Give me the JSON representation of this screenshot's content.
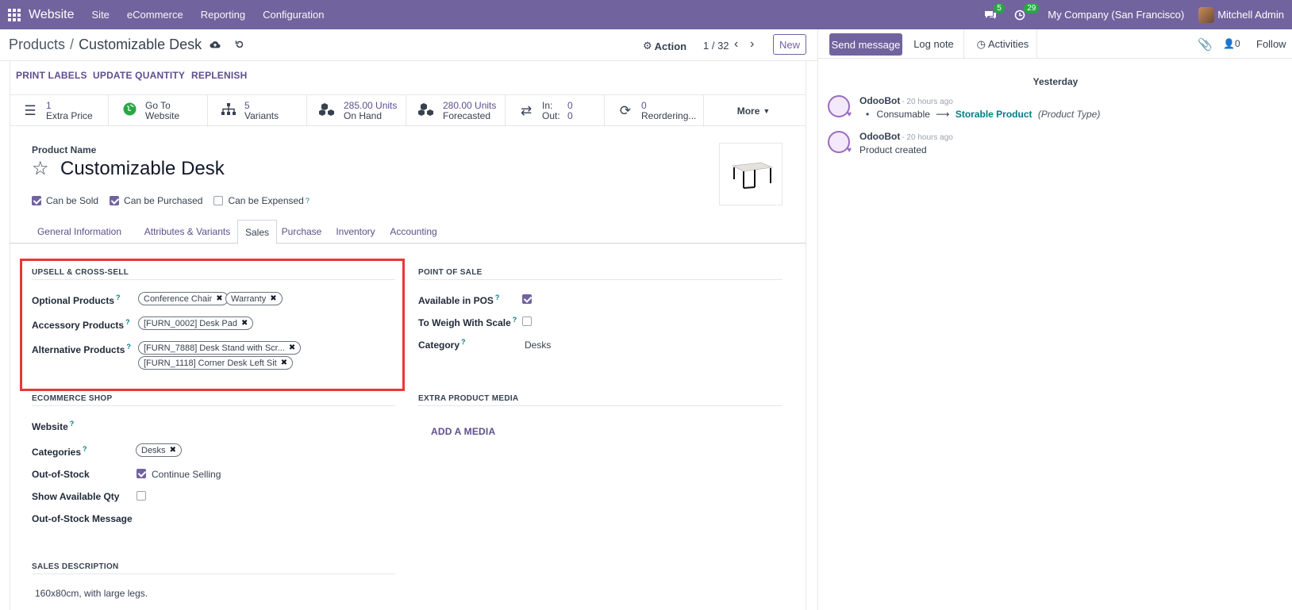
{
  "navbar": {
    "brand": "Website",
    "menus": [
      "Site",
      "eCommerce",
      "Reporting",
      "Configuration"
    ],
    "messages_count": "5",
    "activities_count": "29",
    "company": "My Company (San Francisco)",
    "user": "Mitchell Admin"
  },
  "control": {
    "breadcrumb_parent": "Products",
    "breadcrumb_sep": "/",
    "breadcrumb_current": "Customizable Desk",
    "action_label": "Action",
    "pager": "1 / 32",
    "new_label": "New"
  },
  "header_buttons": {
    "print_labels": "PRINT LABELS",
    "update_quantity": "UPDATE QUANTITY",
    "replenish": "REPLENISH"
  },
  "smart_buttons": {
    "extra_price_value": "1",
    "extra_price_label": "Extra Price",
    "website_value": "Go To",
    "website_label": "Website",
    "variants_value": "5",
    "variants_label": "Variants",
    "onhand_value": "285.00 Units",
    "onhand_label": "On Hand",
    "forecast_value": "280.00 Units",
    "forecast_label": "Forecasted",
    "in_label": "In:",
    "in_value": "0",
    "out_label": "Out:",
    "out_value": "0",
    "reorder_value": "0",
    "reorder_label": "Reordering...",
    "more_label": "More"
  },
  "product": {
    "name_label": "Product Name",
    "name": "Customizable Desk",
    "can_be_sold": "Can be Sold",
    "can_be_purchased": "Can be Purchased",
    "can_be_expensed": "Can be Expensed"
  },
  "tabs": [
    "General Information",
    "Attributes & Variants",
    "Sales",
    "Purchase",
    "Inventory",
    "Accounting"
  ],
  "upsell": {
    "title": "UPSELL & CROSS-SELL",
    "optional_label": "Optional Products",
    "optional_tags": [
      "Conference Chair",
      "Warranty"
    ],
    "accessory_label": "Accessory Products",
    "accessory_tags": [
      "[FURN_0002] Desk Pad"
    ],
    "alternative_label": "Alternative Products",
    "alternative_tags": [
      "[FURN_7888] Desk Stand with Scr...",
      "[FURN_1118] Corner Desk Left Sit"
    ]
  },
  "pos": {
    "title": "POINT OF SALE",
    "available_label": "Available in POS",
    "weigh_label": "To Weigh With Scale",
    "category_label": "Category",
    "category_value": "Desks"
  },
  "ecommerce": {
    "title": "ECOMMERCE SHOP",
    "website_label": "Website",
    "categories_label": "Categories",
    "categories_tags": [
      "Desks"
    ],
    "out_of_stock_label": "Out-of-Stock",
    "continue_selling": "Continue Selling",
    "show_qty_label": "Show Available Qty",
    "oos_message_label": "Out-of-Stock Message"
  },
  "media": {
    "title": "EXTRA PRODUCT MEDIA",
    "add_label": "ADD A MEDIA"
  },
  "sales_description": {
    "title": "SALES DESCRIPTION",
    "text": "160x80cm, with large legs."
  },
  "chatter": {
    "send_message": "Send message",
    "log_note": "Log note",
    "activities": "Activities",
    "followers_count": "0",
    "follow": "Follow",
    "day": "Yesterday",
    "messages": [
      {
        "author": "OdooBot",
        "time": "- 20 hours ago",
        "old": "Consumable",
        "new": "Storable Product",
        "field": "(Product Type)"
      },
      {
        "author": "OdooBot",
        "time": "- 20 hours ago",
        "text": "Product created"
      }
    ]
  },
  "colors": {
    "brand": "#71639e",
    "link": "#5e4f8c",
    "highlight": "#e53935",
    "badge": "#28a745"
  }
}
